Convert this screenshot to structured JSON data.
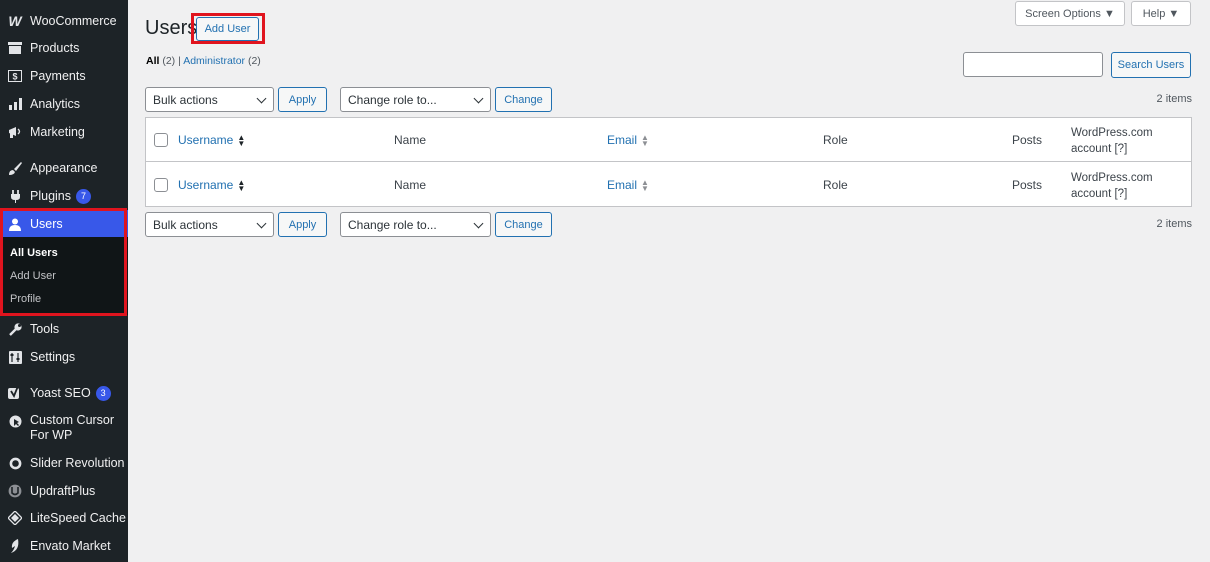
{
  "sidebar": {
    "items": [
      {
        "label": "WooCommerce",
        "icon": "woocommerce-icon"
      },
      {
        "label": "Products",
        "icon": "products-icon"
      },
      {
        "label": "Payments",
        "icon": "payments-icon"
      },
      {
        "label": "Analytics",
        "icon": "analytics-icon"
      },
      {
        "label": "Marketing",
        "icon": "marketing-icon"
      },
      {
        "label": "Appearance",
        "icon": "appearance-icon"
      },
      {
        "label": "Plugins",
        "icon": "plugins-icon",
        "badge": "7"
      },
      {
        "label": "Users",
        "icon": "users-icon"
      },
      {
        "label": "Tools",
        "icon": "tools-icon"
      },
      {
        "label": "Settings",
        "icon": "settings-icon"
      },
      {
        "label": "Yoast SEO",
        "icon": "yoast-icon",
        "badge": "3"
      },
      {
        "label": "Custom Cursor For WP",
        "icon": "cursor-icon"
      },
      {
        "label": "Slider Revolution",
        "icon": "slider-revolution-icon"
      },
      {
        "label": "UpdraftPlus",
        "icon": "updraftplus-icon"
      },
      {
        "label": "LiteSpeed Cache",
        "icon": "litespeed-icon"
      },
      {
        "label": "Envato Market",
        "icon": "envato-icon"
      }
    ],
    "users_submenu": [
      "All Users",
      "Add User",
      "Profile"
    ]
  },
  "header": {
    "title": "Users",
    "add_new": "Add User",
    "screen_options": "Screen Options ▼",
    "help": "Help ▼"
  },
  "filters": {
    "all_label": "All",
    "all_count": "(2)",
    "sep": "|",
    "admin_label": "Administrator",
    "admin_count": "(2)"
  },
  "search": {
    "button": "Search Users",
    "value": ""
  },
  "tablenav": {
    "bulk_actions": "Bulk actions",
    "apply": "Apply",
    "change_role": "Change role to...",
    "change": "Change",
    "items_count": "2 items"
  },
  "table": {
    "columns": {
      "username": "Username",
      "name": "Name",
      "email": "Email",
      "role": "Role",
      "posts": "Posts",
      "wpcom_line1": "WordPress.com",
      "wpcom_line2": "account  [?]"
    }
  },
  "colors": {
    "sidebar_bg": "#1d2327",
    "accent": "#3858e9",
    "link": "#2271b1",
    "highlight": "#e0141e"
  }
}
